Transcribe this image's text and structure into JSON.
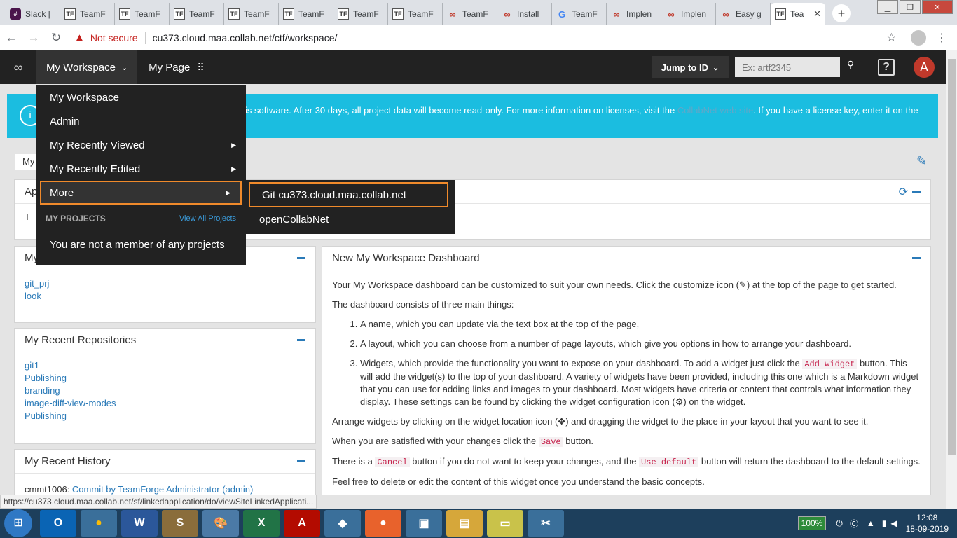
{
  "browser": {
    "tabs": [
      {
        "title": "Slack |",
        "icon": "slack"
      },
      {
        "title": "TeamF",
        "icon": "tf"
      },
      {
        "title": "TeamF",
        "icon": "tf"
      },
      {
        "title": "TeamF",
        "icon": "tf"
      },
      {
        "title": "TeamF",
        "icon": "tf"
      },
      {
        "title": "TeamF",
        "icon": "tf"
      },
      {
        "title": "TeamF",
        "icon": "tf"
      },
      {
        "title": "TeamF",
        "icon": "tf"
      },
      {
        "title": "TeamF",
        "icon": "link"
      },
      {
        "title": "Install",
        "icon": "link"
      },
      {
        "title": "TeamF",
        "icon": "google"
      },
      {
        "title": "Implen",
        "icon": "link"
      },
      {
        "title": "Implen",
        "icon": "link"
      },
      {
        "title": "Easy g",
        "icon": "link"
      },
      {
        "title": "Tea",
        "icon": "tf"
      }
    ],
    "not_secure": "Not secure",
    "url": "cu373.cloud.maa.collab.net/ctf/workspace/"
  },
  "topnav": {
    "workspace": "My Workspace",
    "mypage": "My Page",
    "jump": "Jump to ID",
    "jump_placeholder": "Ex: artf2345",
    "help": "?",
    "avatar": "A"
  },
  "banner": {
    "text_a": "is software. After 30 days, all project data will become read-only. For more information on licenses, visit the ",
    "link": "CollabNet web site",
    "text_b": ". If you have a license key, enter it on the"
  },
  "ws_name": "My",
  "panels": {
    "app_title": "Ap",
    "app_body": "T",
    "projects_title": "My",
    "projects": [
      "git_prj",
      "look"
    ],
    "repos_title": "My Recent Repositories",
    "repos": [
      "git1",
      "Publishing",
      "branding",
      "image-diff-view-modes",
      "Publishing"
    ],
    "history_title": "My Recent History",
    "history_prefix": "cmmt1006: ",
    "history_link": "Commit by TeamForge Administrator (admin)"
  },
  "dashboard": {
    "title": "New My Workspace Dashboard",
    "p1a": "Your My Workspace dashboard can be customized to suit your own needs. Click the customize icon (",
    "p1b": ") at the top of the page to get started.",
    "p2": "The dashboard consists of three main things:",
    "li1": "A name, which you can update via the text box at the top of the page,",
    "li2": "A layout, which you can choose from a number of page layouts, which give you options in how to arrange your dashboard.",
    "li3a": "Widgets, which provide the functionality you want to expose on your dashboard. To add a widget just click the ",
    "li3_code": "Add widget",
    "li3b": " button. This will add the widget(s) to the top of your dashboard. A variety of widgets have been provided, including this one which is a Markdown widget that you can use for adding links and images to your dashboard. Most widgets have criteria or content that controls what information they display. These settings can be found by clicking the widget configuration icon (",
    "li3c": ") on the widget.",
    "p3a": "Arrange widgets by clicking on the widget location icon (",
    "p3b": ") and dragging the widget to the place in your layout that you want to see it.",
    "p4a": "When you are satisfied with your changes click the ",
    "p4_code": "Save",
    "p4b": " button.",
    "p5a": "There is a ",
    "p5_code1": "Cancel",
    "p5b": " button if you do not want to keep your changes, and the ",
    "p5_code2": "Use default",
    "p5c": " button will return the dashboard to the default settings.",
    "p6": "Feel free to delete or edit the content of this widget once you understand the basic concepts."
  },
  "dropdown": {
    "items": [
      "My Workspace",
      "Admin",
      "My Recently Viewed",
      "My Recently Edited"
    ],
    "more": "More",
    "projects_header": "MY PROJECTS",
    "view_all": "View All Projects",
    "no_projects": "You are not a member of any projects"
  },
  "submenu": {
    "git": "Git cu373.cloud.maa.collab.net",
    "ocn": "openCollabNet"
  },
  "statusbar": "https://cu373.cloud.maa.collab.net/sf/linkedapplication/do/viewSiteLinkedApplicati...",
  "taskbar": {
    "battery": "100%",
    "time": "12:08",
    "date": "18-09-2019"
  },
  "colors": {
    "accent": "#2a7ab8",
    "banner": "#1bbde0",
    "highlight": "#f08a2b",
    "nav": "#222222"
  }
}
